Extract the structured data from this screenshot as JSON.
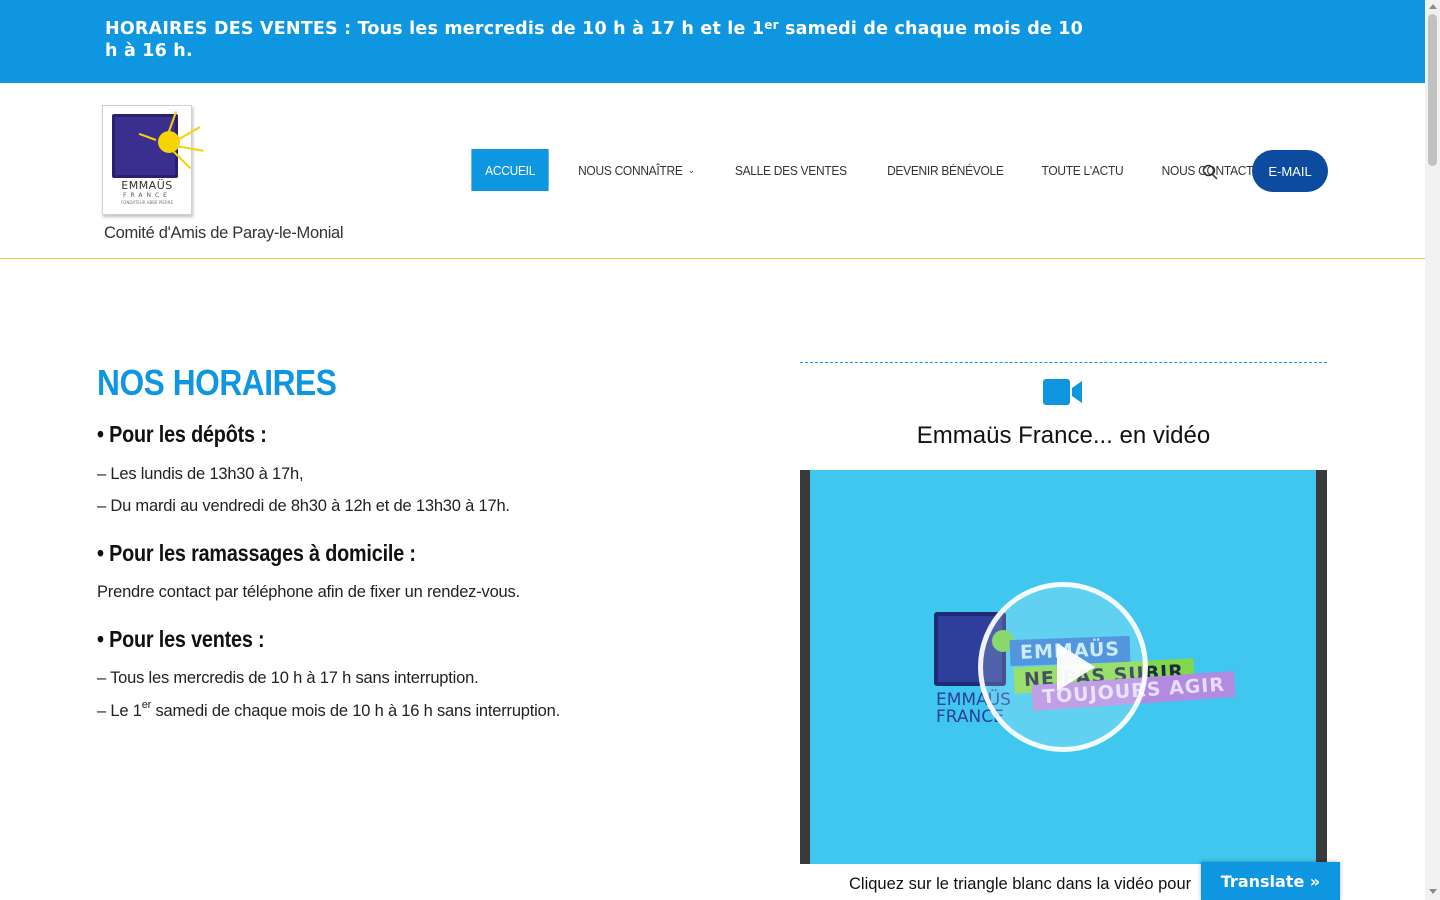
{
  "topbar": {
    "text_prefix": "HORAIRES DES VENTES : Tous les mercredis de 10 h à 17 h et le 1",
    "text_sup": "er",
    "text_suffix": " samedi de chaque mois de 10 h à 16 h."
  },
  "header": {
    "logo_word": "EMMAÜS",
    "logo_country": "FRANCE",
    "logo_founder": "FONDATEUR ABBÉ PIERRE",
    "tagline": "Comité d'Amis de Paray-le-Monial",
    "nav": [
      {
        "label": "ACCUEIL"
      },
      {
        "label": "NOUS CONNAÎTRE"
      },
      {
        "label": "SALLE DES VENTES"
      },
      {
        "label": "DEVENIR BÉNÉVOLE"
      },
      {
        "label": "TOUTE L'ACTU"
      },
      {
        "label": "NOUS CONTACTER"
      }
    ],
    "email_label": "E-MAIL"
  },
  "hours": {
    "title": "NOS HORAIRES",
    "deposits_heading": "• Pour les dépôts :",
    "deposits_line1": "– Les lundis de 13h30 à 17h,",
    "deposits_line2": "– Du mardi au vendredi de 8h30 à 12h et de 13h30 à 17h.",
    "pickups_heading": "• Pour les ramassages à domicile :",
    "pickups_line1": "Prendre contact par téléphone afin de fixer un rendez-vous.",
    "sales_heading": "• Pour les ventes :",
    "sales_line1": "– Tous les mercredis de 10 h à 17 h sans interruption.",
    "sales_line2_prefix": "– Le 1",
    "sales_line2_sup": "er",
    "sales_line2_suffix": " samedi de chaque mois de 10 h à 16 h sans interruption."
  },
  "video": {
    "title": "Emmaüs France... en vidéo",
    "thumb_word": "EMMAÜS",
    "thumb_country": "FRANCE",
    "band1": "EMMAÜS",
    "band2": "NE PAS SUBIR",
    "band3": "TOUJOURS AGIR",
    "caption": "Cliquez sur le triangle blanc dans la vidéo pour"
  },
  "translate_label": "Translate »",
  "colors": {
    "accent": "#0f96e0",
    "email_button": "#0d4b9e",
    "header_border": "#e8c84a",
    "video_bg": "#3fc7ef"
  },
  "icons": {
    "search": "search-icon",
    "video": "video-camera-icon",
    "play": "play-icon",
    "chevron": "chevron-down-icon"
  }
}
